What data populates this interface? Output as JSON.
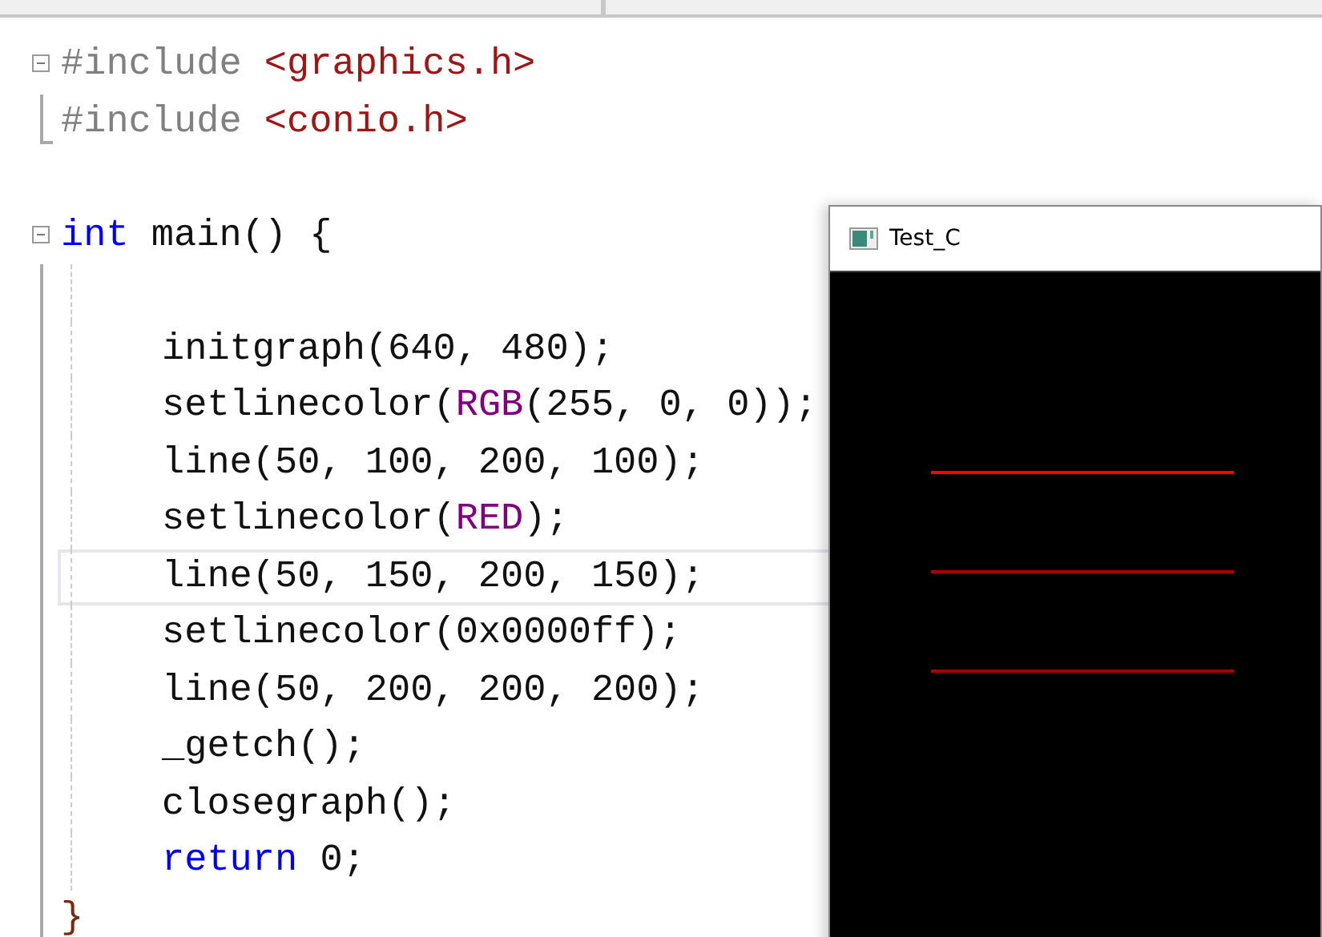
{
  "code_lines": [
    {
      "expanded": true,
      "current": false,
      "tokens": [
        {
          "kind": "preproc",
          "text": "#include"
        },
        {
          "kind": "header",
          "text": "<graphics.h>",
          "spaced": true
        }
      ],
      "children": [
        {
          "current": false,
          "tokens": [
            {
              "kind": "preproc",
              "text": "#include"
            },
            {
              "kind": "header",
              "text": "<conio.h>",
              "spaced": true
            }
          ]
        }
      ]
    },
    {
      "current": false
    },
    {
      "expanded": true,
      "current": false,
      "tokens": [
        {
          "kind": "keyword",
          "text": "int"
        },
        {
          "kind": "plain",
          "text": "main() {",
          "spaced": true
        }
      ],
      "end_tokens": [
        {
          "kind": "brace",
          "text": "}"
        }
      ],
      "children": [
        {
          "current": false
        },
        {
          "current": false,
          "tokens": [
            {
              "kind": "plain",
              "text": "initgraph(640, 480);"
            }
          ]
        },
        {
          "current": false,
          "tokens": [
            {
              "kind": "plain",
              "text": "setlinecolor("
            },
            {
              "kind": "macro",
              "text": "RGB"
            },
            {
              "kind": "plain",
              "text": "(255, 0, 0));"
            }
          ]
        },
        {
          "current": false,
          "tokens": [
            {
              "kind": "plain",
              "text": "line(50, 100, 200, 100);"
            }
          ]
        },
        {
          "current": false,
          "tokens": [
            {
              "kind": "plain",
              "text": "setlinecolor("
            },
            {
              "kind": "macro",
              "text": "RED"
            },
            {
              "kind": "plain",
              "text": ");"
            }
          ]
        },
        {
          "current": true,
          "tokens": [
            {
              "kind": "plain",
              "text": "line(50, 150, 200, 150);"
            }
          ]
        },
        {
          "current": false,
          "tokens": [
            {
              "kind": "plain",
              "text": "setlinecolor(0x0000ff);"
            }
          ]
        },
        {
          "current": false,
          "tokens": [
            {
              "kind": "plain",
              "text": "line(50, 200, 200, 200);"
            }
          ]
        },
        {
          "current": false,
          "tokens": [
            {
              "kind": "plain",
              "text": "_getch();"
            }
          ]
        },
        {
          "current": false,
          "tokens": [
            {
              "kind": "plain",
              "text": "closegraph();"
            }
          ]
        },
        {
          "current": false,
          "tokens": [
            {
              "kind": "keyword",
              "text": "return"
            },
            {
              "kind": "plain",
              "text": "0;",
              "spaced": true
            }
          ]
        }
      ]
    }
  ],
  "graphics_window": {
    "title": "Test_C",
    "lines": [
      {
        "color": "#ff0000"
      },
      {
        "color": "#aa0000"
      },
      {
        "color": "#aa0000"
      }
    ]
  }
}
